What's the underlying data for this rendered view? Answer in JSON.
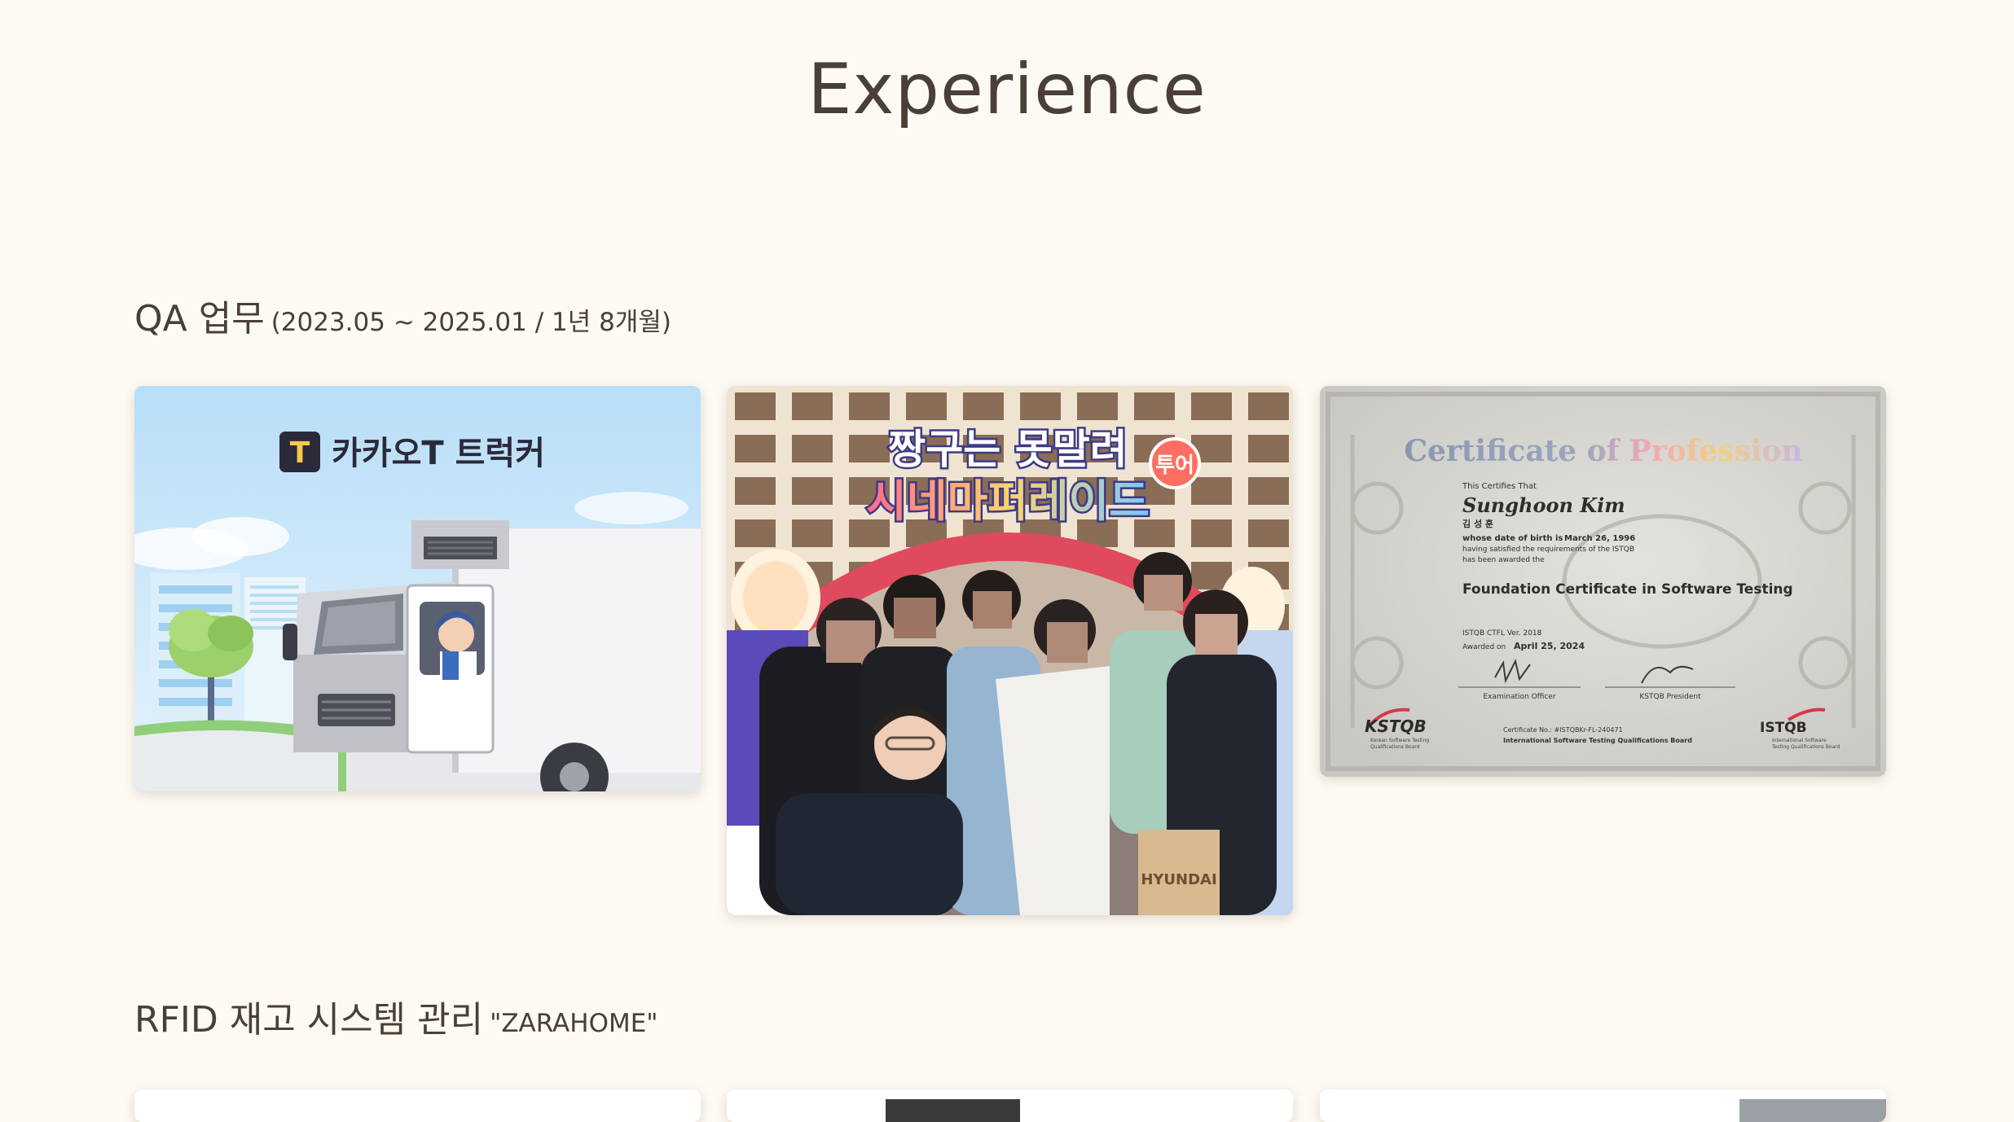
{
  "page": {
    "title": "Experience"
  },
  "sections": [
    {
      "title": "QA 업무",
      "subtitle": "(2023.05 ~ 2025.01 / 1년 8개월)",
      "cards": [
        {
          "kind": "kakao-t-trucker",
          "brand_text": "카카오T 트럭커",
          "logo_letter": "T"
        },
        {
          "kind": "team-photo",
          "banner_line1": "짱구는 못말려",
          "banner_badge": "투어",
          "banner_line2": "시네마퍼레이드",
          "bag_text": "HYUNDAI"
        },
        {
          "kind": "certificate",
          "heading": "Certificate of Profession",
          "certifies": "This Certifies That",
          "name": "Sunghoon Kim",
          "name_kr": "김 성 훈",
          "dob_label": "whose date of birth is",
          "dob": "March 26, 1996",
          "req_line1": "having satisfied the requirements of the ISTQB",
          "req_line2": "has been awarded the",
          "cert_title": "Foundation Certificate in Software Testing",
          "version": "ISTQB CTFL Ver. 2018",
          "awarded_label": "Awarded on",
          "awarded_date": "April 25, 2024",
          "officer": "Examination Officer",
          "president": "KSTQB President",
          "left_logo": "KSTQB",
          "left_logo_sub1": "Korean Software Testing",
          "left_logo_sub2": "Qualifications Board",
          "cert_no": "Certificate No.: #ISTQBKr-FL-240471",
          "board": "International Software Testing Qualifications Board",
          "right_logo": "ISTQB",
          "right_logo_sub1": "International Software",
          "right_logo_sub2": "Testing Qualifications Board"
        }
      ]
    },
    {
      "title": "RFID 재고 시스템 관리",
      "subtitle": "\"ZARAHOME\""
    }
  ],
  "colors": {
    "background": "#fdfaf3",
    "text": "#4a3f36",
    "kakao_sky": "#cfe8fb",
    "kakao_logo": "#2b2a3a"
  }
}
